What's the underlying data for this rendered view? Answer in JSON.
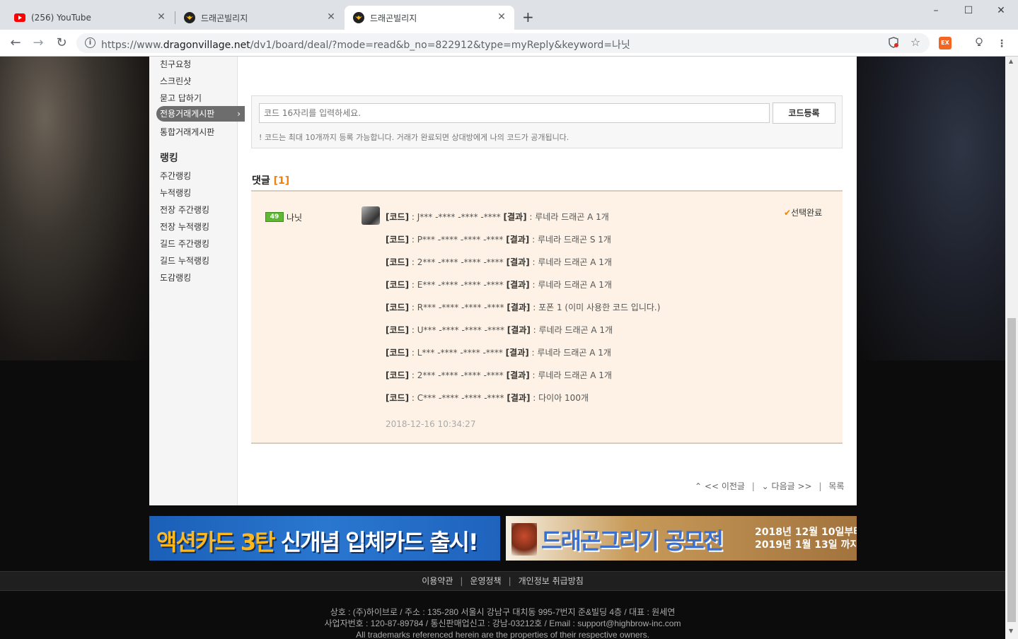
{
  "tabs": [
    {
      "title": "(256) YouTube",
      "icon": "youtube-icon"
    },
    {
      "title": "드래곤빌리지",
      "icon": "dragonvillage-icon"
    },
    {
      "title": "드래곤빌리지",
      "icon": "dragonvillage-icon"
    }
  ],
  "toolbar": {
    "url_prefix": "https://www.",
    "url_domain": "dragonvillage.net",
    "url_path": "/dv1/board/deal/?mode=read&b_no=822912&type=myReply&keyword=나닛",
    "ext_label": "EX"
  },
  "sidebar": {
    "items": [
      "친구요청",
      "스크린샷",
      "묻고 답하기",
      "전용거래게시판",
      "통합거래게시판"
    ],
    "ranking_title": "랭킹",
    "ranking_items": [
      "주간랭킹",
      "누적랭킹",
      "전장 주간랭킹",
      "전장 누적랭킹",
      "길드 주간랭킹",
      "길드 누적랭킹",
      "도감랭킹"
    ]
  },
  "code": {
    "placeholder": "코드 16자리를 입력하세요.",
    "button": "코드등록",
    "notice": "! 코드는 최대 10개까지 등록 가능합니다. 거래가 완료되면 상대방에게 나의 코드가 공개됩니다."
  },
  "comments": {
    "title": "댓글",
    "count": "[1]",
    "level": "49",
    "nickname": "나닛",
    "code_tag": "[코드]",
    "result_tag": "[결과]",
    "rows": [
      {
        "code": " : J*** -**** -**** -**** ",
        "result": " : 루네라 드래곤 A 1개"
      },
      {
        "code": " : P*** -**** -**** -**** ",
        "result": " : 루네라 드래곤 S 1개"
      },
      {
        "code": " : 2*** -**** -**** -**** ",
        "result": " : 루네라 드래곤 A 1개"
      },
      {
        "code": " : E*** -**** -**** -**** ",
        "result": " : 루네라 드래곤 A 1개"
      },
      {
        "code": " : R*** -**** -**** -**** ",
        "result": " : 포폰 1 (이미 사용한 코드 입니다.)"
      },
      {
        "code": " : U*** -**** -**** -**** ",
        "result": " : 루네라 드래곤 A 1개"
      },
      {
        "code": " : L*** -**** -**** -**** ",
        "result": " : 루네라 드래곤 A 1개"
      },
      {
        "code": " : 2*** -**** -**** -**** ",
        "result": " : 루네라 드래곤 A 1개"
      },
      {
        "code": " : C*** -**** -**** -**** ",
        "result": " : 다이아 100개"
      }
    ],
    "date": "2018-12-16 10:34:27",
    "status": "선택완료"
  },
  "pagenav": {
    "prev": "<< 이전글",
    "next": "다음글 >>",
    "list": "목록"
  },
  "banners": {
    "left_a": "액션카드 3탄",
    "left_b": "신개념 입체카드 출시!",
    "right_title": "드래곤그리기 공모전",
    "right_date1": "2018년 12월 10일부터",
    "right_date2": "2019년  1월 13일 까지"
  },
  "footer": {
    "links": [
      "이용약관",
      "운영정책",
      "개인정보 취급방침"
    ],
    "line1": "상호 : (주)하이브로 / 주소 : 135-280 서울시 강남구 대치동 995-7번지 준&빌딩 4층 / 대표 : 원세연",
    "line2": "사업자번호 : 120-87-89784 / 통신판매업신고 : 강남-03212호 / Email : support@highbrow-inc.com",
    "line3": "All trademarks referenced herein are the properties of their respective owners."
  }
}
